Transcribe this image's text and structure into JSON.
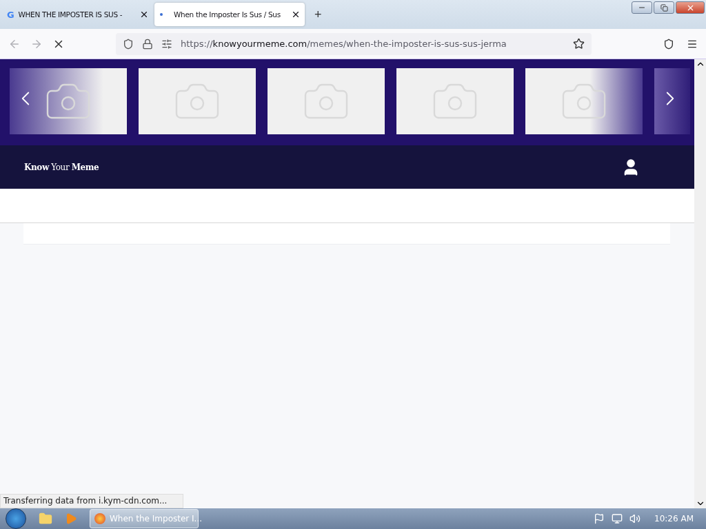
{
  "tabs": [
    {
      "label": "WHEN THE IMPOSTER IS SUS -",
      "kind": "google",
      "favicon": "G",
      "selected": false
    },
    {
      "label": "When the Imposter Is Sus / Sus",
      "kind": "loading",
      "selected": true
    }
  ],
  "new_tab": "+",
  "address": {
    "scheme": "https://",
    "host": "knowyourmeme.com",
    "path": "/memes/when-the-imposter-is-sus-sus-jerma"
  },
  "loading": true,
  "carousel": [
    {
      "kind": "fadein"
    },
    {
      "kind": "plain"
    },
    {
      "kind": "plain"
    },
    {
      "kind": "plain"
    },
    {
      "kind": "fadeout"
    },
    {
      "kind": "partial"
    }
  ],
  "site_logo": "**Know** Your **Meme**",
  "status_text": "Transferring data from i.kym-cdn.com...",
  "taskbar": {
    "window_button": "When the Imposter I...",
    "clock": "10:26 AM"
  }
}
